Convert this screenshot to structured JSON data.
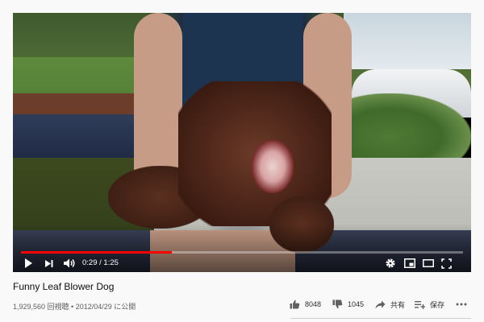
{
  "player": {
    "current_time": "0:29",
    "duration": "1:25",
    "time_separator": " / ",
    "progress_fraction": 0.341,
    "accent_color": "#ff0000"
  },
  "icons": {
    "play": "play-icon",
    "next": "next-icon",
    "volume": "volume-icon",
    "settings": "gear-icon",
    "miniplayer": "miniplayer-icon",
    "theater": "theater-icon",
    "fullscreen": "fullscreen-icon",
    "like": "thumbs-up-icon",
    "dislike": "thumbs-down-icon",
    "share": "share-icon",
    "save": "save-playlist-icon",
    "more": "more-icon"
  },
  "video": {
    "title": "Funny Leaf Blower Dog",
    "views": "1,929,560 回視聴",
    "date": "2012/04/29 に公開"
  },
  "actions": {
    "likes": "8048",
    "dislikes": "1045",
    "share_label": "共有",
    "save_label": "保存"
  }
}
